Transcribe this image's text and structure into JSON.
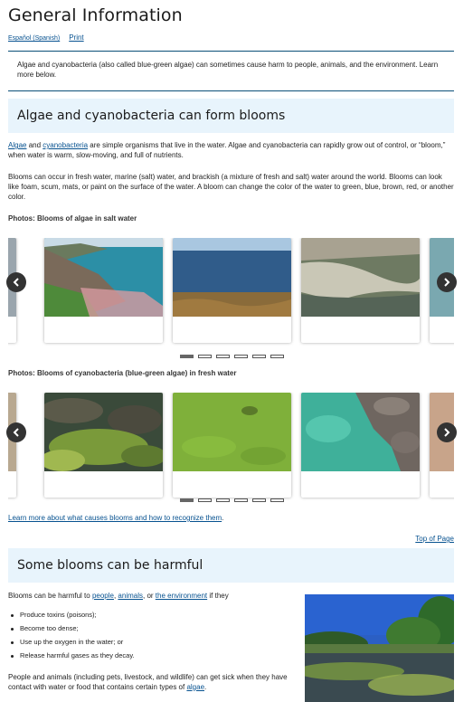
{
  "page": {
    "title": "General Information",
    "lang_link": "Español (Spanish)",
    "print_link": "Print",
    "intro": "Algae and cyanobacteria (also called blue-green algae) can sometimes cause harm to people, animals, and the environment. Learn more below."
  },
  "section1": {
    "heading": "Algae and cyanobacteria can form blooms",
    "p1_link1": "Algae",
    "p1_and": " and ",
    "p1_link2": "cyanobacteria",
    "p1_rest": " are simple organisms that live in the water. Algae and cyanobacteria can rapidly grow out of control, or “bloom,” when water is warm, slow-moving, and full of nutrients.",
    "p2": "Blooms can occur in fresh water, marine (salt) water, and brackish (a mixture of fresh and salt) water around the world. Blooms can look like foam, scum, mats, or paint on the surface of the water. A bloom can change the color of the water to green, blue, brown, red, or another color.",
    "photos1_label": "Photos: Blooms of algae in salt water",
    "photos2_label": "Photos: Blooms of cyanobacteria (blue-green algae) in fresh water",
    "carousel1": {
      "active_slide": 1,
      "slide_count": 6
    },
    "carousel2": {
      "active_slide": 1,
      "slide_count": 6
    },
    "learn_more": "Learn more about what causes blooms and how to recognize them",
    "learn_more_tail": ".",
    "top_of_page": "Top of Page"
  },
  "section2": {
    "heading": "Some blooms can be harmful",
    "intro_pre": "Blooms can be harmful to ",
    "link_people": "people",
    "comma1": ", ",
    "link_animals": "animals",
    "or_text": ", or ",
    "link_env": "the environment",
    "intro_post": " if they",
    "bullets": [
      "Produce toxins (poisons);",
      "Become too dense;",
      "Use up the oxygen in the water; or",
      "Release harmful gases as they decay."
    ],
    "para_pre": "People and animals (including pets, livestock, and wildlife) can get sick when they have contact with water or food that contains certain types of ",
    "para_link": "algae",
    "para_post": "."
  },
  "icons": {
    "prev": "chevron-left-icon",
    "next": "chevron-right-icon"
  }
}
